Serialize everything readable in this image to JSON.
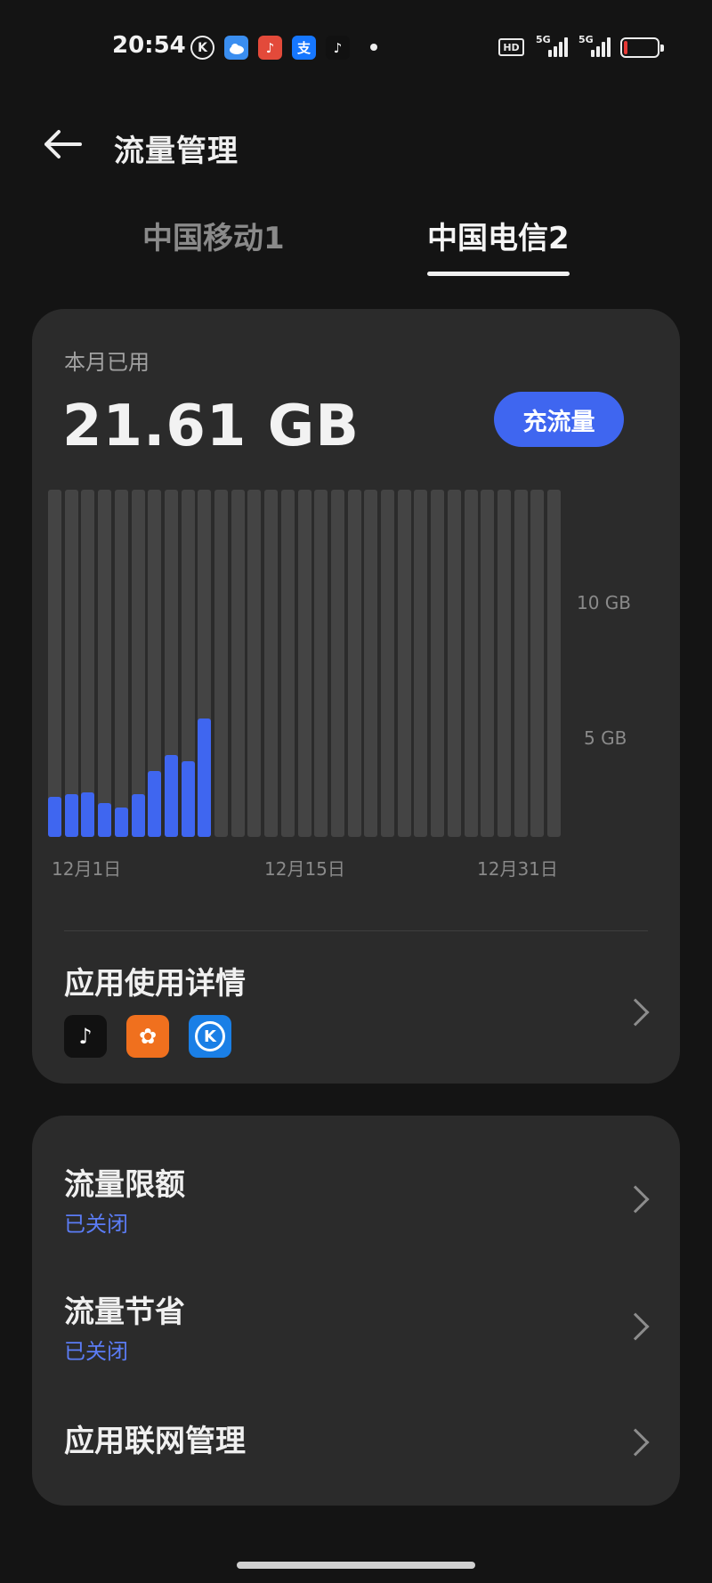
{
  "status_bar": {
    "time": "20:54",
    "notification_icons": [
      "kugou-icon",
      "weather-icon",
      "music-icon",
      "alipay-icon",
      "tiktok-icon",
      "dot-icon"
    ],
    "hd_label": "HD",
    "sim1_network": "5G",
    "sim2_network": "5G",
    "battery_level": "low"
  },
  "header": {
    "title": "流量管理"
  },
  "tabs": [
    {
      "label": "中国移动1",
      "selected": false
    },
    {
      "label": "中国电信2",
      "selected": true
    }
  ],
  "usage": {
    "label": "本月已用",
    "value": "21.61 GB",
    "recharge_label": "充流量"
  },
  "chart_data": {
    "type": "bar",
    "x_tick_labels": [
      "12月1日",
      "12月15日",
      "12月31日"
    ],
    "y_tick_labels": [
      "10 GB",
      "5 GB"
    ],
    "y_ticks": [
      10,
      5
    ],
    "ylim": [
      0,
      12.9
    ],
    "unit": "GB",
    "days": 31,
    "values": [
      1.5,
      1.6,
      1.65,
      1.25,
      1.1,
      1.6,
      2.45,
      3.05,
      2.8,
      4.4
    ],
    "colors": {
      "used": "#3f66f0",
      "empty": "#444444"
    }
  },
  "app_usage": {
    "title": "应用使用详情",
    "apps": [
      "tiktok-icon",
      "squirrel-icon",
      "kugou-icon"
    ]
  },
  "settings": {
    "data_limit": {
      "title": "流量限额",
      "status": "已关闭"
    },
    "data_saver": {
      "title": "流量节省",
      "status": "已关闭"
    },
    "app_network": {
      "title": "应用联网管理"
    }
  },
  "colors": {
    "accent": "#3f66f0",
    "status_text": "#5b7cf5",
    "card": "#2b2b2b",
    "background": "#141414"
  }
}
